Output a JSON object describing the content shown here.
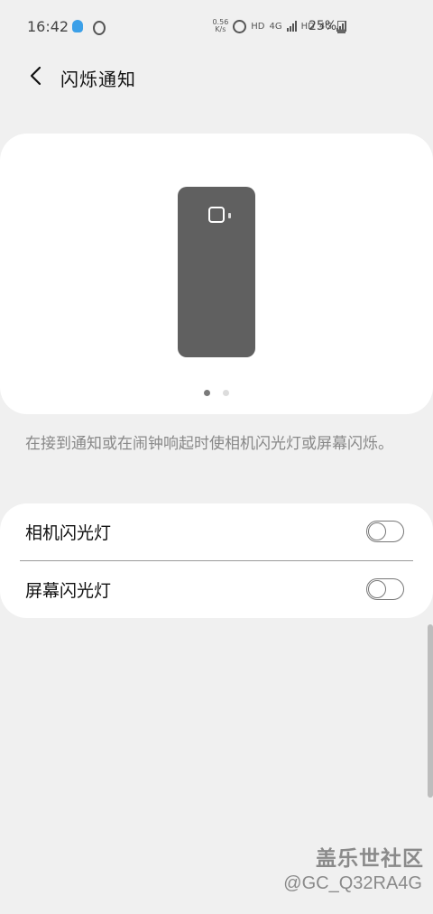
{
  "status_bar": {
    "time": "16:42",
    "net_speed_value": "0.56",
    "net_speed_unit": "K/s",
    "hd1": "HD",
    "net1": "4G",
    "hd2": "HD",
    "net2": "4G",
    "battery": "25%",
    "icons": [
      "qq-icon",
      "app-icon",
      "alarm-icon",
      "signal-icon",
      "signal-icon",
      "battery-icon"
    ]
  },
  "header": {
    "title": "闪烁通知"
  },
  "preview": {
    "page_count": 2,
    "active_page": 1
  },
  "description": "在接到通知或在闹钟响起时使相机闪光灯或屏幕闪烁。",
  "settings": [
    {
      "label": "相机闪光灯",
      "enabled": false
    },
    {
      "label": "屏幕闪光灯",
      "enabled": false
    }
  ],
  "watermark": {
    "brand": "盖乐世社区",
    "user": "@GC_Q32RA4G"
  },
  "colors": {
    "background": "#f0f0f0",
    "card": "#ffffff",
    "phone": "#606060"
  }
}
